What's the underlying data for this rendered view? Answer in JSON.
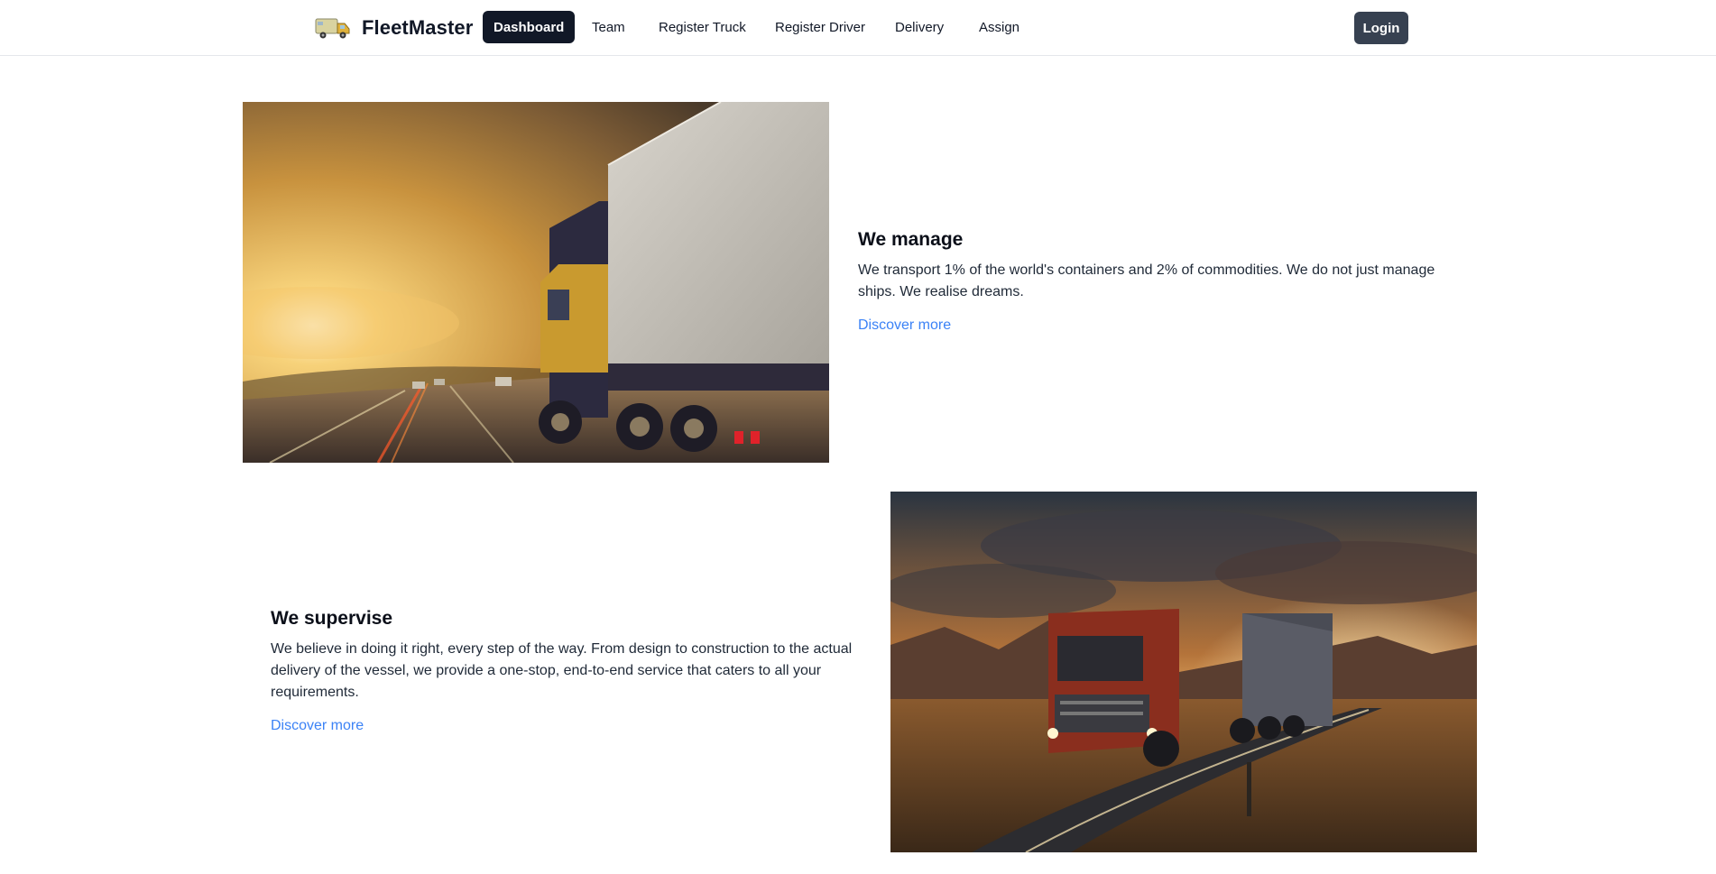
{
  "brand": {
    "name": "FleetMaster",
    "logo_icon": "delivery-truck-icon"
  },
  "nav": {
    "items": [
      {
        "label": "Dashboard",
        "active": true
      },
      {
        "label": "Team",
        "active": false
      },
      {
        "label": "Register Truck",
        "active": false
      },
      {
        "label": "Register Driver",
        "active": false
      },
      {
        "label": "Delivery",
        "active": false
      },
      {
        "label": "Assign",
        "active": false
      }
    ],
    "login_label": "Login"
  },
  "features": [
    {
      "title": "We manage",
      "body": "We transport 1% of the world's containers and 2% of commodities. We do not just manage ships. We realise dreams.",
      "link": "Discover more"
    },
    {
      "title": "We supervise",
      "body": "We believe in doing it right, every step of the way. From design to construction to the actual delivery of the vessel, we provide a one-stop, end-to-end service that caters to all your requirements.",
      "link": "Discover more"
    }
  ],
  "colors": {
    "nav_active_bg": "#111827",
    "login_bg": "#374151",
    "link": "#3b82f6"
  }
}
